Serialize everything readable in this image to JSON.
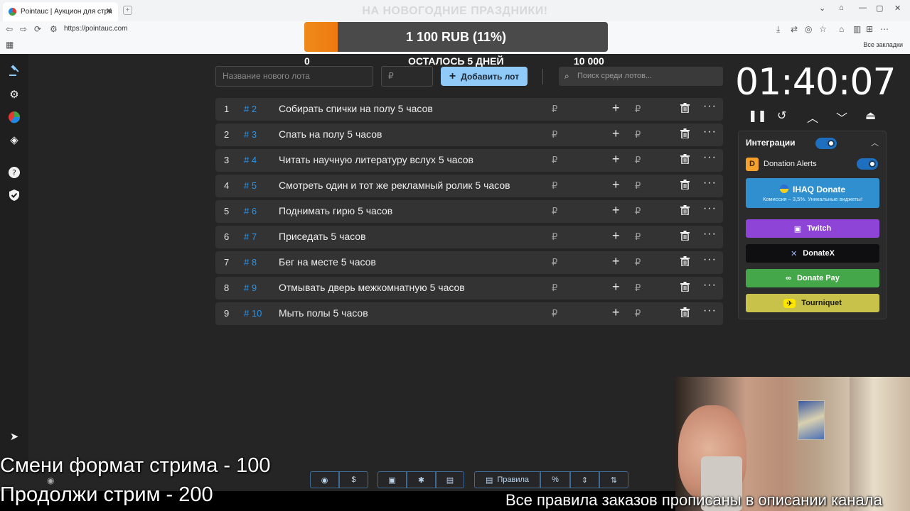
{
  "browser": {
    "tab_title": "Pointauc | Аукцион для стримеров",
    "url": "https://pointauc.com",
    "bookmarks_label": "Все закладки"
  },
  "goal": {
    "title": "НА НОВОГОДНИЕ ПРАЗДНИКИ!",
    "amount_label": "1 100 RUB (11%)",
    "progress_percent": 11,
    "min_label": "0",
    "max_label": "10 000",
    "days_left_label": "ОСТАЛОСЬ 5 ДНЕЙ"
  },
  "controls": {
    "lot_name_placeholder": "Название нового лота",
    "amount_placeholder": "₽",
    "add_button_label": "Добавить лот",
    "search_placeholder": "Поиск среди лотов..."
  },
  "lots": [
    {
      "num": "1",
      "id": "# 2",
      "name": "Собирать спички на полу 5 часов",
      "currency": "₽"
    },
    {
      "num": "2",
      "id": "# 3",
      "name": "Спать на полу 5 часов",
      "currency": "₽"
    },
    {
      "num": "3",
      "id": "# 4",
      "name": "Читать научную литературу вслух 5 часов",
      "currency": "₽"
    },
    {
      "num": "4",
      "id": "# 5",
      "name": "Смотреть один и тот же рекламный ролик 5 часов",
      "currency": "₽"
    },
    {
      "num": "5",
      "id": "# 6",
      "name": "Поднимать гирю 5 часов",
      "currency": "₽"
    },
    {
      "num": "6",
      "id": "# 7",
      "name": "Приседать 5 часов",
      "currency": "₽"
    },
    {
      "num": "7",
      "id": "# 8",
      "name": "Бег на месте 5 часов",
      "currency": "₽"
    },
    {
      "num": "8",
      "id": "# 9",
      "name": "Отмывать дверь межкомнатную 5 часов",
      "currency": "₽"
    },
    {
      "num": "9",
      "id": "# 10",
      "name": "Мыть полы 5 часов",
      "currency": "₽"
    }
  ],
  "timer": {
    "display": "01:40:07"
  },
  "integrations": {
    "title": "Интеграции",
    "donation_alerts_label": "Donation Alerts",
    "ihaq_label": "IHAQ Donate",
    "ihaq_sub": "Комиссия – 3,5%. Уникальные виджеты!",
    "twitch_label": "Twitch",
    "donatex_label": "DonateX",
    "donatepay_label": "Donate Pay",
    "tourniquet_label": "Tourniquet",
    "colors": {
      "ihaq": "#2f8fcf",
      "twitch": "#8e44d6",
      "donatex": "#0f0f12",
      "donatepay": "#44a84a",
      "tourniquet": "#c8c24a"
    }
  },
  "toolbar": {
    "rules_label": "Правила"
  },
  "stream_overlay": {
    "line1": "Смени формат стрима - 100",
    "line2": "Продолжи стрим - 200",
    "footer": "Все правила заказов прописаны в описании канала"
  }
}
